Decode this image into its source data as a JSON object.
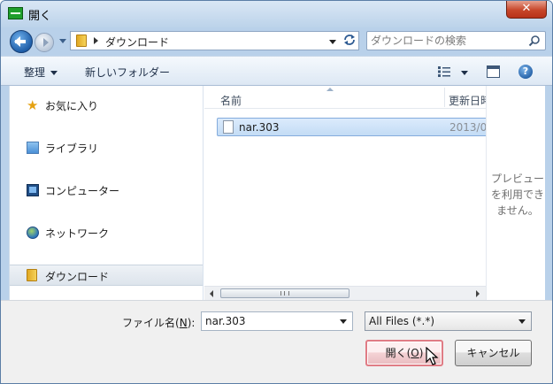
{
  "window": {
    "title": "開く",
    "close_label": "✕"
  },
  "nav": {
    "address": "ダウンロード",
    "search_placeholder": "ダウンロードの検索"
  },
  "toolbar": {
    "organize_label": "整理",
    "new_folder_label": "新しいフォルダー",
    "help_label": "?"
  },
  "sidebar": {
    "items": [
      {
        "label": "お気に入り",
        "icon": "star-icon"
      },
      {
        "label": "ライブラリ",
        "icon": "library-icon"
      },
      {
        "label": "コンピューター",
        "icon": "computer-icon"
      },
      {
        "label": "ネットワーク",
        "icon": "network-icon"
      },
      {
        "label": "ダウンロード",
        "icon": "folder-icon",
        "selected": true
      }
    ]
  },
  "file_list": {
    "columns": [
      "名前",
      "更新日時"
    ],
    "rows": [
      {
        "name": "nar.303",
        "date": "2013/0",
        "selected": true
      }
    ]
  },
  "preview": {
    "message": "プレビューを利用できません。"
  },
  "footer": {
    "filename_label": "ファイル名",
    "filename_key": "N",
    "filename_value": "nar.303",
    "filetype_value": "All Files (*.*)",
    "open_label": "開く",
    "open_key": "O",
    "cancel_label": "キャンセル"
  },
  "colors": {
    "accent": "#84acdd",
    "window_frame": "#b9d1ea",
    "close": "#c7462a"
  }
}
